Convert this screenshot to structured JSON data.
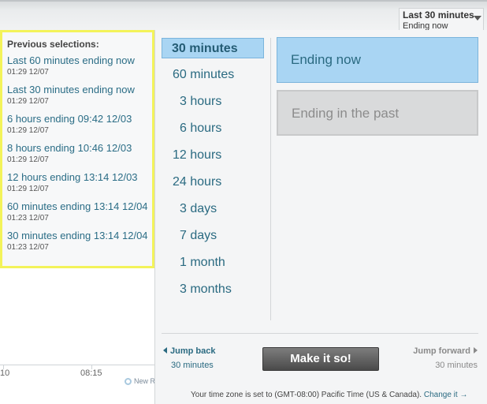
{
  "range_trigger": {
    "line1": "Last 30 minutes",
    "line2": "Ending now"
  },
  "chart_fragment": {
    "tick_labels": [
      "10",
      "08:15"
    ],
    "legend_label": "New Re"
  },
  "previous": {
    "title": "Previous selections:",
    "items": [
      {
        "label": "Last 60 minutes ending now",
        "date": "01:29 12/07"
      },
      {
        "label": "Last 30 minutes ending now",
        "date": "01:29 12/07"
      },
      {
        "label": "6 hours ending 09:42 12/03",
        "date": "01:29 12/07"
      },
      {
        "label": "8 hours ending 10:46 12/03",
        "date": "01:29 12/07"
      },
      {
        "label": "12 hours ending 13:14 12/03",
        "date": "01:29 12/07"
      },
      {
        "label": "60 minutes ending 13:14 12/04",
        "date": "01:23 12/07"
      },
      {
        "label": "30 minutes ending 13:14 12/04",
        "date": "01:23 12/07"
      }
    ]
  },
  "durations": [
    "30 minutes",
    "60 minutes",
    "3 hours",
    "6 hours",
    "12 hours",
    "24 hours",
    "3 days",
    "7 days",
    "1 month",
    "3 months"
  ],
  "selected_duration": "30 minutes",
  "ending": {
    "now": "Ending now",
    "past": "Ending in the past",
    "selected": "Ending now"
  },
  "jump_back": {
    "label": "Jump back",
    "amount": "30 minutes"
  },
  "jump_forward": {
    "label": "Jump forward",
    "amount": "30 minutes"
  },
  "make_button": "Make it so!",
  "timezone": {
    "text": "Your time zone is set to (GMT-08:00) Pacific Time (US & Canada).",
    "link": "Change it →"
  },
  "colors": {
    "accent": "#2a6a81",
    "selected_bg": "#a9d5f3",
    "highlight_border": "#f3f35a"
  }
}
